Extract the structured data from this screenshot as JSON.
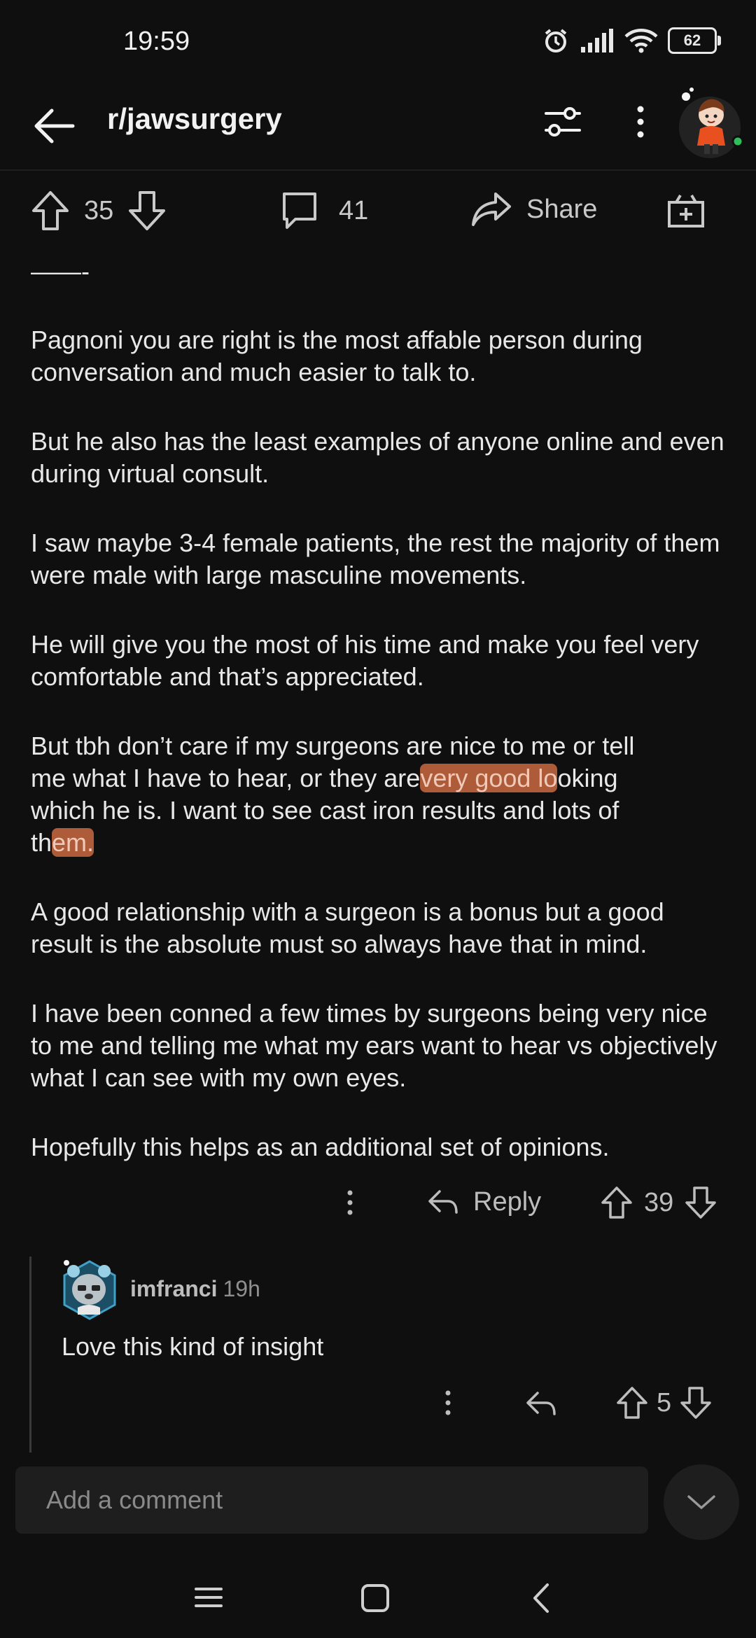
{
  "status_bar": {
    "time": "19:59",
    "battery": "62",
    "icons": [
      "alarm-icon",
      "signal-icon",
      "wifi-icon",
      "battery-icon"
    ]
  },
  "nav": {
    "title": "r/jawsurgery",
    "back_icon": "back-arrow-icon",
    "filter_icon": "filter-sliders-icon",
    "more_icon": "more-vertical-icon"
  },
  "post_actions": {
    "upvotes": "35",
    "comments": "41",
    "share_label": "Share"
  },
  "post": {
    "divider_text": "——-",
    "paragraphs": [
      "Pagnoni you are right is the most affable person during conversation and much easier to talk to.",
      "But he also has the least examples of anyone online and even during virtual consult.",
      "I saw maybe 3-4 female patients, the rest the majority of them were male with large masculine movements.",
      "He will give you the most of his time and make you feel very comfortable and that’s appreciated."
    ],
    "paragraph5": {
      "line1": "But tbh don’t care if my surgeons are nice to me or tell",
      "line2_a": "me what I have to hear, or they are",
      "line2_hl": "very good lo",
      "line2_b": "oking",
      "line3": "which he is. I want to see cast iron results and lots of",
      "line4_a": "th",
      "line4_hl": "em."
    },
    "paragraphs_after": [
      "A good relationship with a surgeon is a bonus but a good result is the absolute must so always have that in mind.",
      "I have been conned a few times by surgeons being very nice to me and telling me what my ears want to hear vs objectively what I can see with my own eyes.",
      "Hopefully this helps as an additional set of opinions."
    ]
  },
  "comment_actions": {
    "reply_label": "Reply",
    "votes": "39"
  },
  "reply": {
    "username": "imfranci",
    "age": "19h",
    "text": "Love this kind of insight",
    "votes": "5"
  },
  "composer": {
    "placeholder": "Add a comment"
  },
  "colors": {
    "background": "#0f0f0f",
    "highlight": "#c9683f",
    "text": "#e8e8e8"
  }
}
